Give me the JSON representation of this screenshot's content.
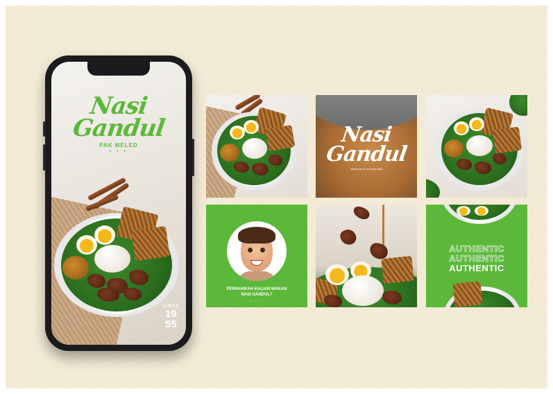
{
  "colors": {
    "background": "#f5ecd8",
    "brand_green": "#5cb83a",
    "phone_body": "#1b1b1d",
    "white": "#ffffff"
  },
  "phone": {
    "brand": {
      "line1": "Nasi",
      "line2": "Gandul",
      "sub": "PAK MELED",
      "dots": "• • •"
    },
    "since": {
      "label": "SINCE",
      "year_top": "19",
      "year_bottom": "55"
    }
  },
  "grid": {
    "soup_tile": {
      "line1": "Nasi",
      "line2": "Gandul",
      "tagline": "Welcome to our food stall"
    },
    "avatar_tile": {
      "question_line1": "PERNAHKAH KALIAN MAKAN",
      "question_line2": "NASI GANDUL?",
      "dots": "• • •"
    },
    "authentic_tile": {
      "word_1": "AUTHENTIC",
      "word_2": "AUTHENTIC",
      "word_3": "AUTHENTIC"
    }
  }
}
